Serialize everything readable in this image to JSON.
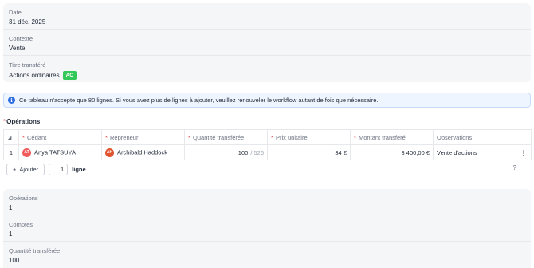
{
  "summary_top": [
    {
      "label": "Date",
      "value": "31 déc. 2025"
    },
    {
      "label": "Contexte",
      "value": "Vente"
    },
    {
      "label": "Titre transféré",
      "value": "Actions ordinaires",
      "badge": "AO"
    }
  ],
  "info_message": "Ce tableau n'accepte que 80 lignes. Si vous avez plus de lignes à ajouter, veuillez renouveler le workflow autant de fois que nécessaire.",
  "operations": {
    "title": "Opérations",
    "required_mark": "*",
    "columns": [
      "Cédant",
      "Repreneur",
      "Quantité transférée",
      "Prix unitaire",
      "Montant transféré",
      "Observations"
    ],
    "rows": [
      {
        "index": "1",
        "cedant": {
          "initials": "AT",
          "name": "Anya TATSUYA",
          "color": "#ef5b5b"
        },
        "repreneur": {
          "initials": "AH",
          "name": "Archibald Haddock",
          "color": "#e0552f"
        },
        "quantity": "100",
        "quantity_max": "/ 526",
        "unit_price": "34 €",
        "amount": "3 400,00 €",
        "observations": "Vente d'actions"
      }
    ],
    "add_button": "Ajouter",
    "add_count": "1",
    "add_unit": "ligne",
    "help": "?"
  },
  "summary_bottom": [
    {
      "label": "Opérations",
      "value": "1"
    },
    {
      "label": "Comptes",
      "value": "1"
    },
    {
      "label": "Quantité transférée",
      "value": "100"
    }
  ]
}
